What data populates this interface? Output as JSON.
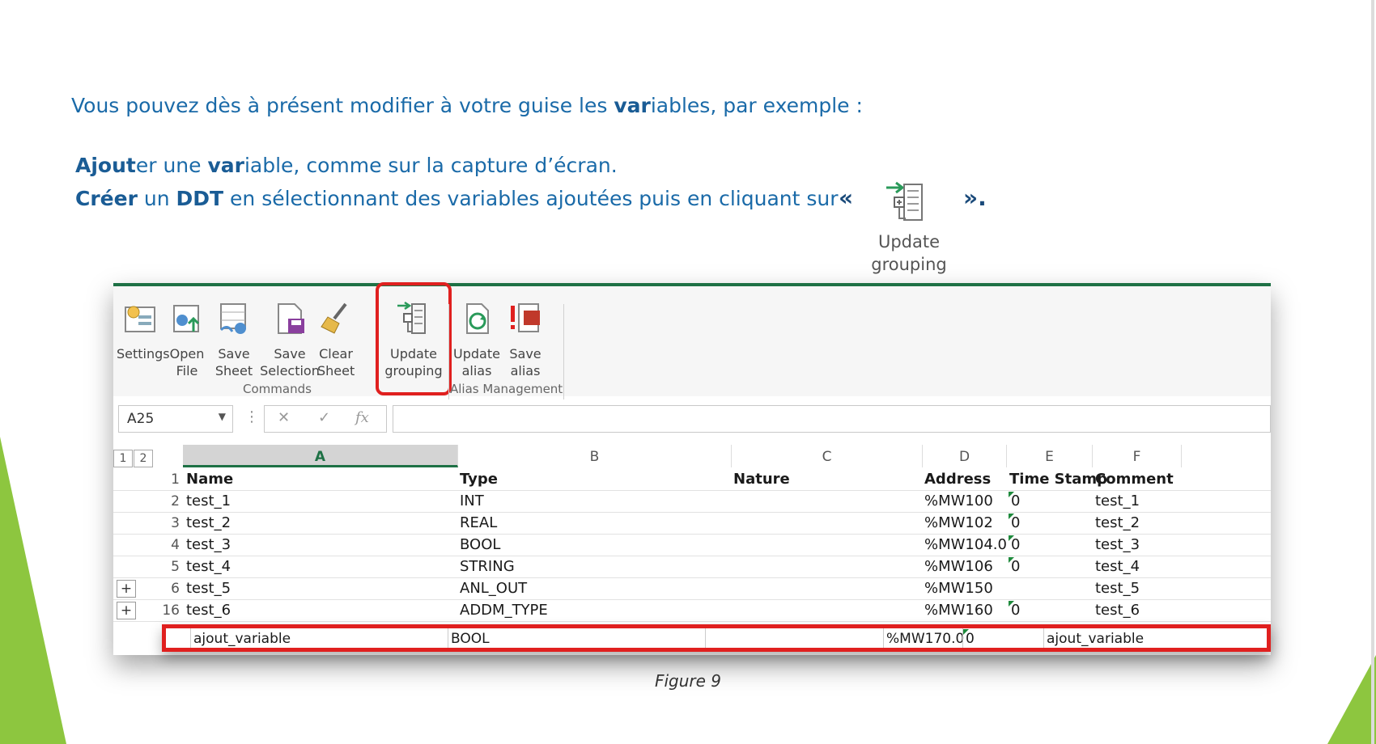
{
  "intro": {
    "before_bold": "Vous pouvez dès à présent modifier à votre guise les ",
    "bold": "var",
    "after_bold": "iables, par exemple :"
  },
  "line2": {
    "bold1": "Ajout",
    "text1": "er une ",
    "bold2": "var",
    "text2": "iable, comme sur la capture d’écran."
  },
  "line3": {
    "bold1": "Créer",
    "text1": " un ",
    "bold2": "DDT",
    "text2": " en sélectionnant des variables ajoutées puis en cliquant sur",
    "quote_open": "«",
    "quote_close": "».",
    "icon_label_1": "Update",
    "icon_label_2": "grouping"
  },
  "ribbon": {
    "buttons": [
      {
        "l1": "Settings",
        "l2": "",
        "icon": "settings-icon"
      },
      {
        "l1": "Open",
        "l2": "File",
        "icon": "open-file-icon"
      },
      {
        "l1": "Save",
        "l2": "Sheet",
        "icon": "save-sheet-icon"
      },
      {
        "l1": "Save",
        "l2": "Selection",
        "icon": "save-selection-icon"
      },
      {
        "l1": "Clear",
        "l2": "Sheet",
        "icon": "clear-sheet-icon"
      },
      {
        "l1": "Update",
        "l2": "grouping",
        "icon": "update-grouping-icon"
      },
      {
        "l1": "Update",
        "l2": "alias",
        "icon": "update-alias-icon"
      },
      {
        "l1": "Save",
        "l2": "alias",
        "icon": "save-alias-icon"
      }
    ],
    "groups": [
      "Commands",
      "Alias Management"
    ]
  },
  "formula_bar": {
    "name_box": "A25",
    "cancel": "✕",
    "enter": "✓",
    "fx": "fx"
  },
  "grid": {
    "outline_levels": [
      "1",
      "2"
    ],
    "columns": [
      "A",
      "B",
      "C",
      "D",
      "E",
      "F"
    ],
    "header_row": {
      "num": "1",
      "cells": [
        "Name",
        "Type",
        "Nature",
        "Address",
        "Time Stamp",
        "Comment"
      ]
    },
    "rows": [
      {
        "num": "2",
        "plus": "",
        "cells": [
          "test_1",
          "INT",
          "",
          "%MW100",
          "0",
          "test_1"
        ]
      },
      {
        "num": "3",
        "plus": "",
        "cells": [
          "test_2",
          "REAL",
          "",
          "%MW102",
          "0",
          "test_2"
        ]
      },
      {
        "num": "4",
        "plus": "",
        "cells": [
          "test_3",
          "BOOL",
          "",
          "%MW104.0",
          "0",
          "test_3"
        ]
      },
      {
        "num": "5",
        "plus": "",
        "cells": [
          "test_4",
          "STRING",
          "",
          "%MW106",
          "0",
          "test_4"
        ]
      },
      {
        "num": "6",
        "plus": "+",
        "cells": [
          "test_5",
          "ANL_OUT",
          "",
          "%MW150",
          "",
          "test_5"
        ]
      },
      {
        "num": "16",
        "plus": "+",
        "cells": [
          "test_6",
          "ADDM_TYPE",
          "",
          "%MW160",
          "0",
          "test_6"
        ]
      }
    ],
    "new_row": {
      "cells": [
        "ajout_variable",
        "BOOL",
        "",
        "%MW170.0",
        "0",
        "ajout_variable"
      ]
    }
  },
  "caption": "Figure 9",
  "colors": {
    "text_blue": "#1a6aa8",
    "excel_green": "#1e7145",
    "highlight_red": "#e0201f",
    "deco_green": "#8dc63f"
  }
}
